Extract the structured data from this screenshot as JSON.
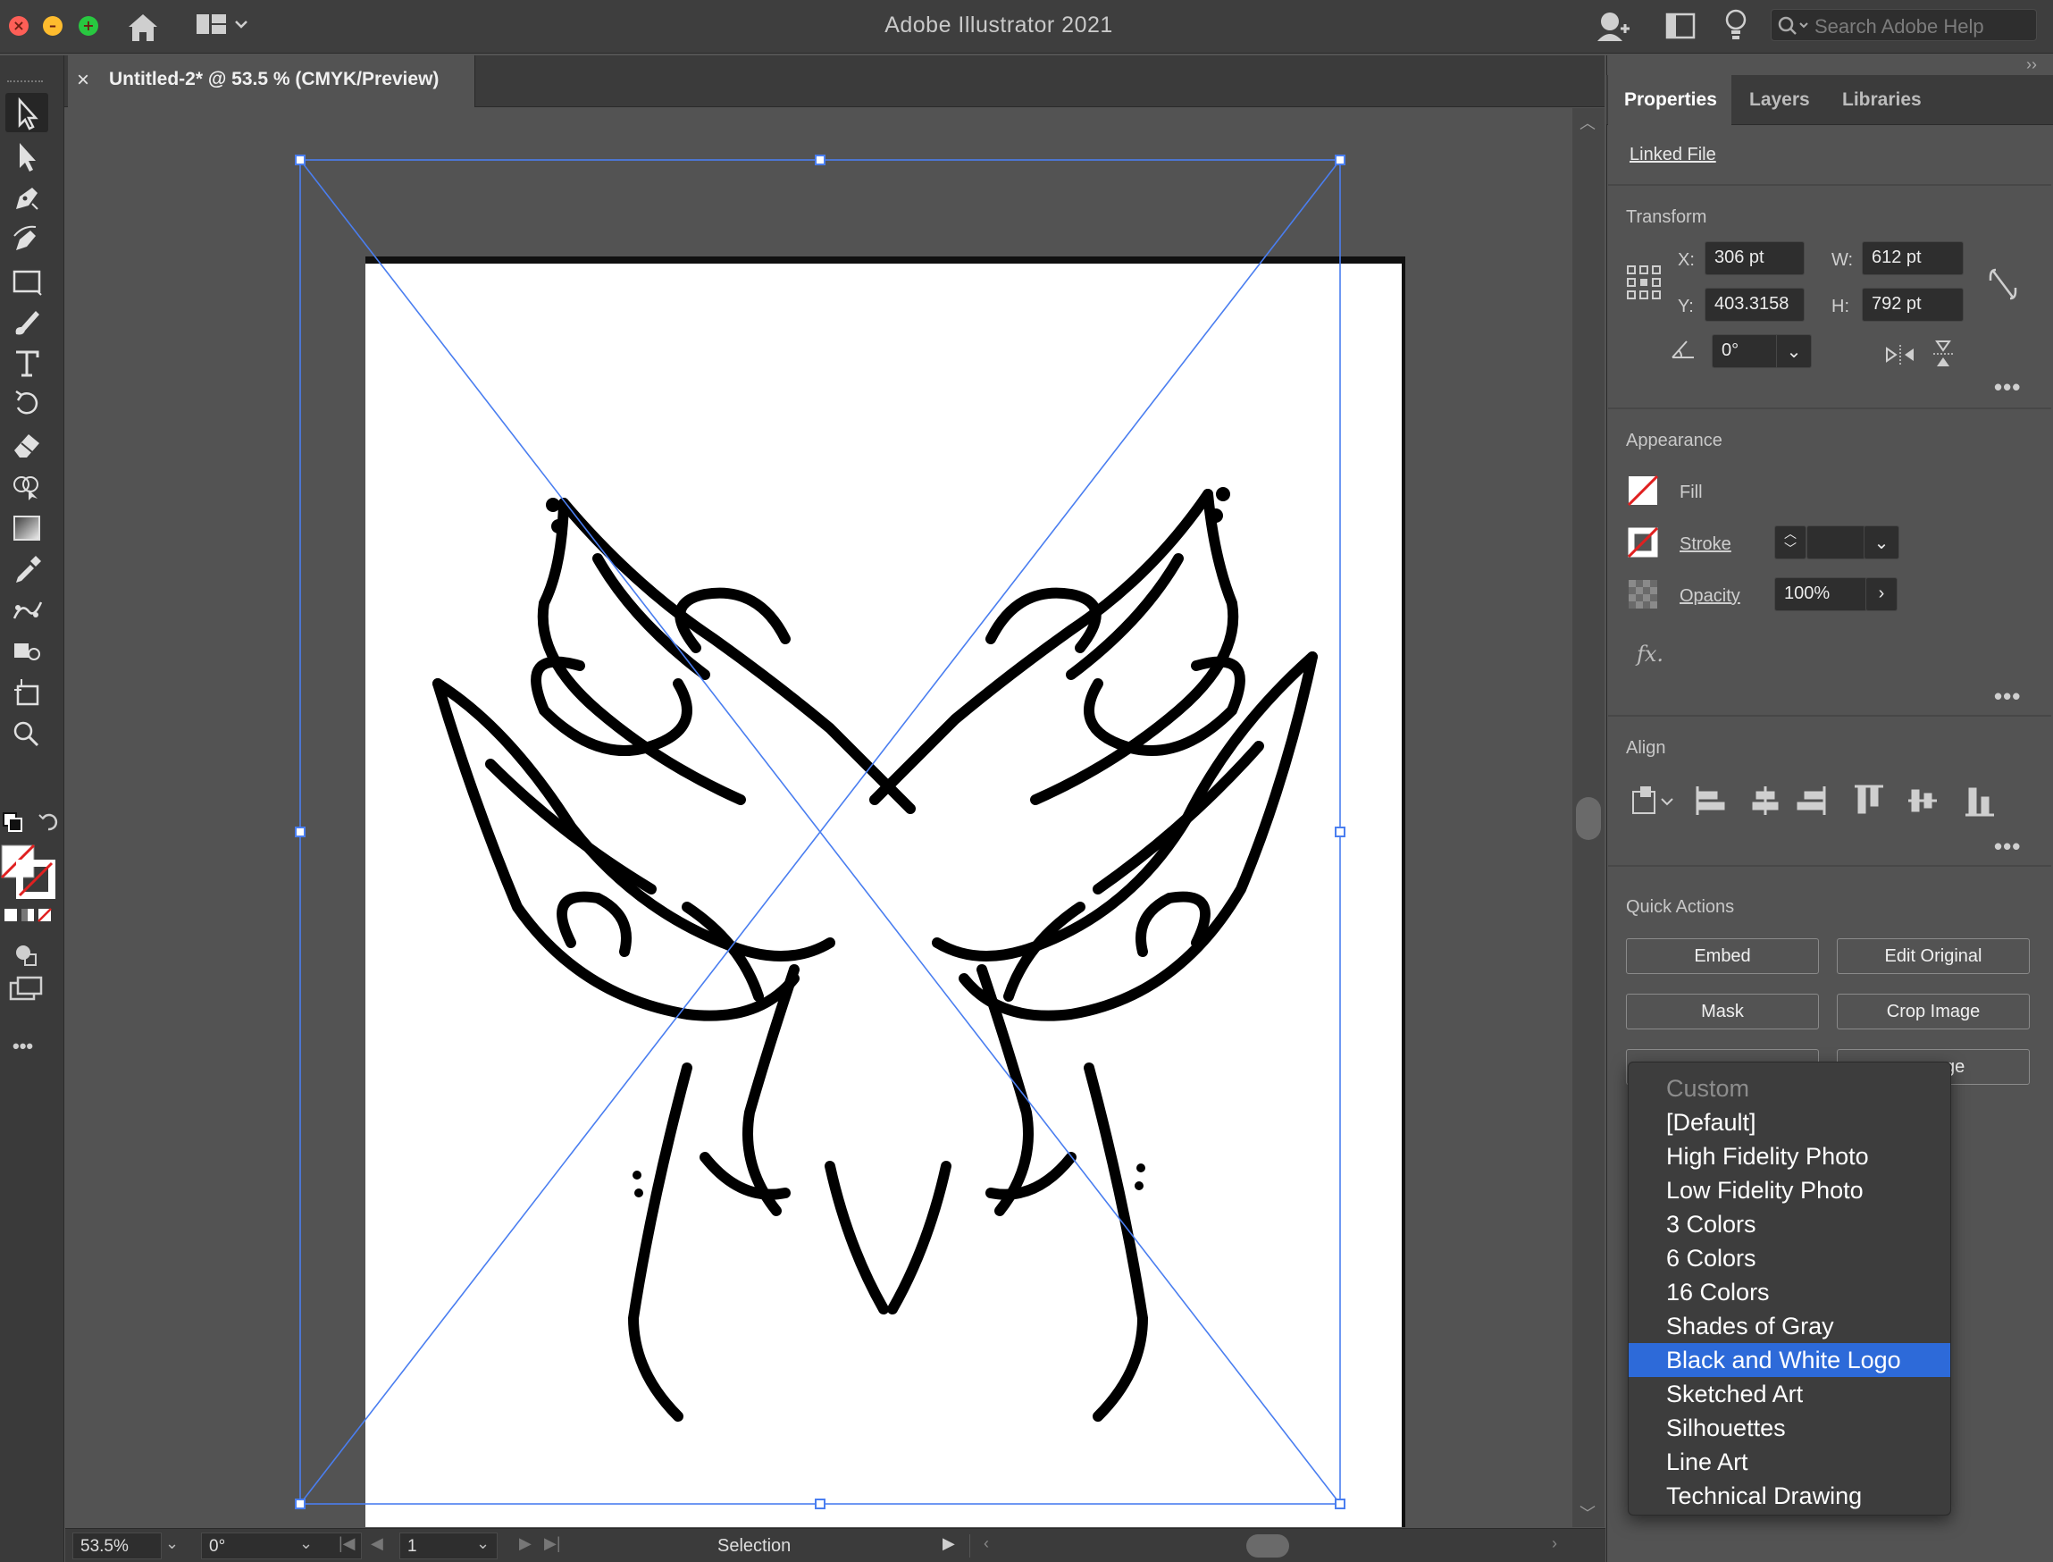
{
  "app": {
    "title": "Adobe Illustrator 2021"
  },
  "search": {
    "placeholder": "Search Adobe Help"
  },
  "document_tab": {
    "close": "×",
    "label": "Untitled-2* @ 53.5 % (CMYK/Preview)"
  },
  "panel": {
    "tabs": [
      "Properties",
      "Layers",
      "Libraries"
    ],
    "linked_file": "Linked File",
    "transform": {
      "title": "Transform",
      "x_label": "X:",
      "x": "306 pt",
      "y_label": "Y:",
      "y": "403.3158",
      "w_label": "W:",
      "w": "612 pt",
      "h_label": "H:",
      "h": "792 pt",
      "angle": "0°"
    },
    "appearance": {
      "title": "Appearance",
      "fill": "Fill",
      "stroke": "Stroke",
      "opacity": "Opacity",
      "opacity_value": "100%",
      "fx": "fx."
    },
    "align": {
      "title": "Align"
    },
    "quick_actions": {
      "title": "Quick Actions",
      "embed": "Embed",
      "edit_original": "Edit Original",
      "mask": "Mask",
      "crop_image": "Crop Image",
      "partial": "ge"
    },
    "more": "•••"
  },
  "dropdown": {
    "items": [
      "Custom",
      "[Default]",
      "High Fidelity Photo",
      "Low Fidelity Photo",
      "3 Colors",
      "6 Colors",
      "16 Colors",
      "Shades of Gray",
      "Black and White Logo",
      "Sketched Art",
      "Silhouettes",
      "Line Art",
      "Technical Drawing"
    ],
    "disabled_item": "Custom",
    "highlighted_item": "Black and White Logo"
  },
  "status": {
    "zoom": "53.5%",
    "rotation": "0°",
    "artboard": "1",
    "tool": "Selection"
  },
  "toolbar": {
    "tools": [
      "selection-tool",
      "direct-selection-tool",
      "pen-tool",
      "curvature-tool",
      "rectangle-tool",
      "paintbrush-tool",
      "type-tool",
      "rotate-tool",
      "eraser-tool",
      "shape-builder-tool",
      "gradient-tool",
      "eyedropper-tool",
      "puppet-warp-tool",
      "symbol-sprayer-tool",
      "artboard-tool",
      "zoom-tool"
    ],
    "more": "•••"
  },
  "colors": {
    "selection": "#4a7ef0",
    "highlight": "#2d6ad9",
    "fill_none": "#e02020"
  }
}
